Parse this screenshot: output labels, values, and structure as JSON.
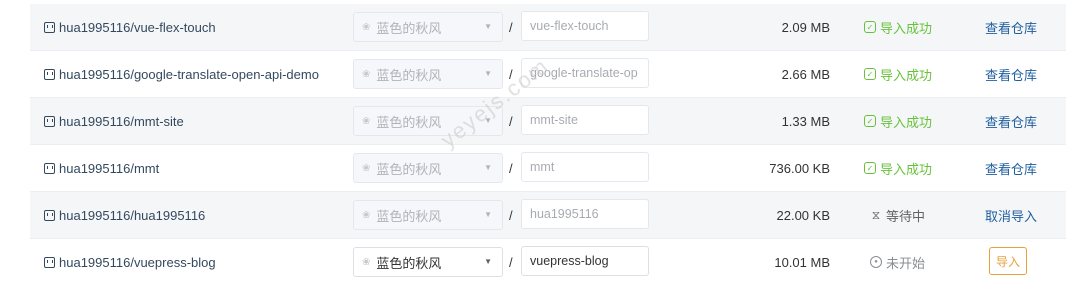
{
  "rows": [
    {
      "repo": "hua1995116/vue-flex-touch",
      "owner": "蓝色的秋风",
      "name": "vue-flex-touch",
      "size": "2.09 MB",
      "status": "导入成功",
      "action": "查看仓库"
    },
    {
      "repo": "hua1995116/google-translate-open-api-demo",
      "owner": "蓝色的秋风",
      "name": "google-translate-op",
      "size": "2.66 MB",
      "status": "导入成功",
      "action": "查看仓库"
    },
    {
      "repo": "hua1995116/mmt-site",
      "owner": "蓝色的秋风",
      "name": "mmt-site",
      "size": "1.33 MB",
      "status": "导入成功",
      "action": "查看仓库"
    },
    {
      "repo": "hua1995116/mmt",
      "owner": "蓝色的秋风",
      "name": "mmt",
      "size": "736.00 KB",
      "status": "导入成功",
      "action": "查看仓库"
    },
    {
      "repo": "hua1995116/hua1995116",
      "owner": "蓝色的秋风",
      "name": "hua1995116",
      "size": "22.00 KB",
      "status": "等待中",
      "action": "取消导入"
    },
    {
      "repo": "hua1995116/vuepress-blog",
      "owner": "蓝色的秋风",
      "name": "vuepress-blog",
      "size": "10.01 MB",
      "status": "未开始",
      "action": "导入"
    }
  ],
  "separator": "/",
  "watermark": "yeyejs.com",
  "icons": {
    "repo": "repo-icon",
    "success": "check-circle-icon",
    "waiting": "hourglass-icon",
    "notstarted": "dot-circle-icon",
    "caret": "caret-down-icon"
  },
  "colors": {
    "success": "#67c23a",
    "link": "#1f5e9e",
    "import_button": "#e6a23c"
  }
}
